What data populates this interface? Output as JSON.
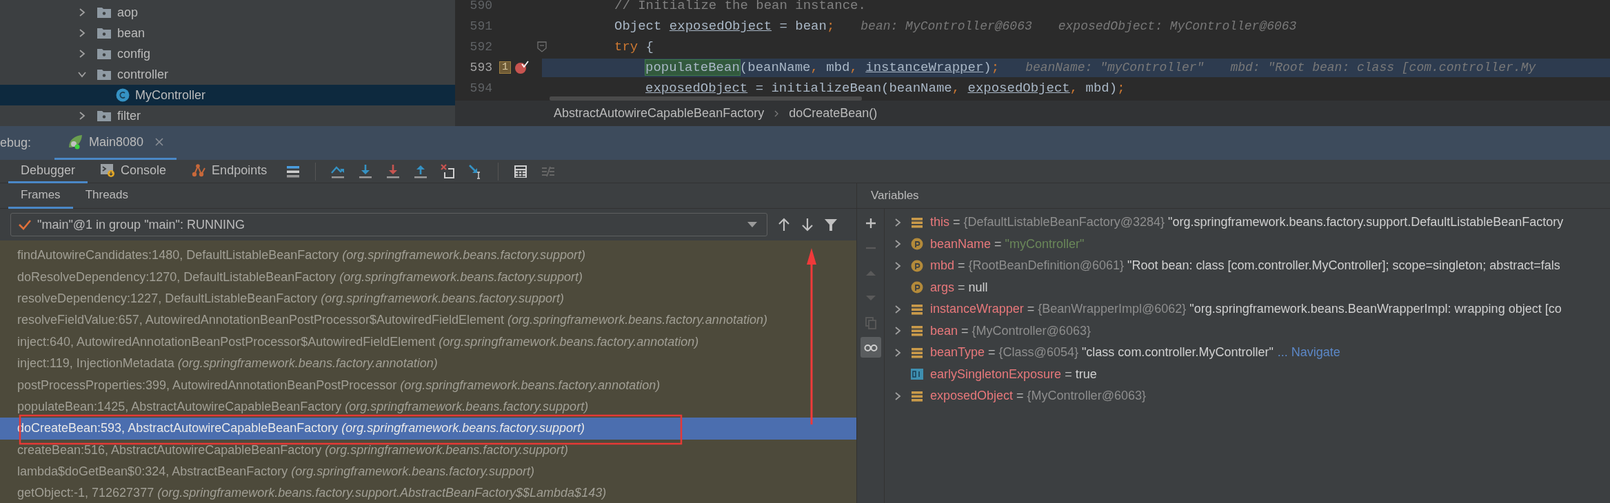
{
  "project_tree": {
    "items": [
      {
        "label": "aop",
        "kind": "folder",
        "expanded": false,
        "selected": false
      },
      {
        "label": "bean",
        "kind": "folder",
        "expanded": false,
        "selected": false
      },
      {
        "label": "config",
        "kind": "folder",
        "expanded": false,
        "selected": false
      },
      {
        "label": "controller",
        "kind": "folder",
        "expanded": true,
        "selected": false,
        "children": [
          {
            "label": "MyController",
            "kind": "class",
            "selected": true
          }
        ]
      },
      {
        "label": "filter",
        "kind": "folder",
        "expanded": false,
        "selected": false
      }
    ]
  },
  "editor": {
    "lines": [
      {
        "number": "590",
        "current": false,
        "foldable": false,
        "breakpoint": false,
        "code": [
          {
            "text": "// Initialize the bean instance.",
            "kind": "comment"
          }
        ]
      },
      {
        "number": "591",
        "current": false,
        "foldable": false,
        "breakpoint": false,
        "code": [
          {
            "text": "Object ",
            "kind": "plain"
          },
          {
            "text": "exposedObject",
            "kind": "var"
          },
          {
            "text": " = bean",
            "kind": "plain"
          },
          {
            "text": ";",
            "kind": "punct"
          }
        ],
        "hints": [
          "bean: MyController@6063",
          "exposedObject: MyController@6063"
        ]
      },
      {
        "number": "592",
        "current": false,
        "foldable": true,
        "breakpoint": false,
        "code": [
          {
            "text": "try",
            "kind": "keyword"
          },
          {
            "text": " {",
            "kind": "plain"
          }
        ]
      },
      {
        "number": "593",
        "current": true,
        "foldable": false,
        "breakpoint": true,
        "badge": "1",
        "nested": true,
        "code": [
          {
            "text": "populateBean",
            "kind": "call"
          },
          {
            "text": "(beanName",
            "kind": "plain"
          },
          {
            "text": ",",
            "kind": "punct"
          },
          {
            "text": " mbd",
            "kind": "plain"
          },
          {
            "text": ", ",
            "kind": "punct"
          },
          {
            "text": "instanceWrapper",
            "kind": "var"
          },
          {
            "text": ")",
            "kind": "plain"
          },
          {
            "text": ";",
            "kind": "punct"
          }
        ],
        "hints": [
          "beanName: \"myController\"",
          "mbd: \"Root bean: class [com.controller.My"
        ]
      },
      {
        "number": "594",
        "current": false,
        "foldable": false,
        "breakpoint": false,
        "nested": true,
        "code": [
          {
            "text": "exposedObject",
            "kind": "var"
          },
          {
            "text": " = initializeBean(beanName",
            "kind": "plain"
          },
          {
            "text": ", ",
            "kind": "punct"
          },
          {
            "text": "exposedObject",
            "kind": "var"
          },
          {
            "text": ",",
            "kind": "punct"
          },
          {
            "text": " mbd)",
            "kind": "plain"
          },
          {
            "text": ";",
            "kind": "punct"
          }
        ]
      }
    ],
    "breadcrumbs": [
      "AbstractAutowireCapableBeanFactory",
      "doCreateBean()"
    ]
  },
  "debug_bar": {
    "label": "ebug:",
    "tabs": [
      {
        "label": "Main8080",
        "selected": true
      }
    ]
  },
  "debug_tabs": [
    {
      "label": "Debugger",
      "kind": "debugger",
      "selected": true
    },
    {
      "label": "Console",
      "kind": "console",
      "selected": false
    },
    {
      "label": "Endpoints",
      "kind": "endpoints",
      "selected": false
    }
  ],
  "frames_panel": {
    "tabs": [
      {
        "label": "Frames",
        "selected": true
      },
      {
        "label": "Threads",
        "selected": false
      }
    ],
    "thread": "\"main\"@1 in group \"main\": RUNNING",
    "frames": [
      {
        "location": "findAutowireCandidates:1480, DefaultListableBeanFactory",
        "package": "(org.springframework.beans.factory.support)",
        "selected": false
      },
      {
        "location": "doResolveDependency:1270, DefaultListableBeanFactory",
        "package": "(org.springframework.beans.factory.support)",
        "selected": false
      },
      {
        "location": "resolveDependency:1227, DefaultListableBeanFactory",
        "package": "(org.springframework.beans.factory.support)",
        "selected": false
      },
      {
        "location": "resolveFieldValue:657, AutowiredAnnotationBeanPostProcessor$AutowiredFieldElement",
        "package": "(org.springframework.beans.factory.annotation)",
        "selected": false
      },
      {
        "location": "inject:640, AutowiredAnnotationBeanPostProcessor$AutowiredFieldElement",
        "package": "(org.springframework.beans.factory.annotation)",
        "selected": false
      },
      {
        "location": "inject:119, InjectionMetadata",
        "package": "(org.springframework.beans.factory.annotation)",
        "selected": false
      },
      {
        "location": "postProcessProperties:399, AutowiredAnnotationBeanPostProcessor",
        "package": "(org.springframework.beans.factory.annotation)",
        "selected": false
      },
      {
        "location": "populateBean:1425, AbstractAutowireCapableBeanFactory",
        "package": "(org.springframework.beans.factory.support)",
        "selected": false
      },
      {
        "location": "doCreateBean:593, AbstractAutowireCapableBeanFactory",
        "package": "(org.springframework.beans.factory.support)",
        "selected": true
      },
      {
        "location": "createBean:516, AbstractAutowireCapableBeanFactory",
        "package": "(org.springframework.beans.factory.support)",
        "selected": false
      },
      {
        "location": "lambda$doGetBean$0:324, AbstractBeanFactory",
        "package": "(org.springframework.beans.factory.support)",
        "selected": false
      },
      {
        "location": "getObject:-1, 712627377",
        "package": "(org.springframework.beans.factory.support.AbstractBeanFactory$$Lambda$143)",
        "selected": false
      }
    ]
  },
  "variables_panel": {
    "title": "Variables",
    "variables": [
      {
        "name": "this",
        "operator": "=",
        "kind": "field",
        "expandable": true,
        "type": "{DefaultListableBeanFactory@3284}",
        "value": "\"org.springframework.beans.factory.support.DefaultListableBeanFactory"
      },
      {
        "name": "beanName",
        "operator": "=",
        "kind": "param",
        "expandable": true,
        "string_value": "\"myController\""
      },
      {
        "name": "mbd",
        "operator": "=",
        "kind": "param",
        "expandable": true,
        "type": "{RootBeanDefinition@6061}",
        "value": "\"Root bean: class [com.controller.MyController]; scope=singleton; abstract=fals"
      },
      {
        "name": "args",
        "operator": "=",
        "kind": "param",
        "expandable": false,
        "value": "null"
      },
      {
        "name": "instanceWrapper",
        "operator": "=",
        "kind": "field",
        "expandable": true,
        "type": "{BeanWrapperImpl@6062}",
        "value": "\"org.springframework.beans.BeanWrapperImpl: wrapping object [co"
      },
      {
        "name": "bean",
        "operator": "=",
        "kind": "field",
        "expandable": true,
        "type": "{MyController@6063}"
      },
      {
        "name": "beanType",
        "operator": "=",
        "kind": "field",
        "expandable": true,
        "type": "{Class@6054}",
        "value": "\"class com.controller.MyController\"",
        "link": "... Navigate"
      },
      {
        "name": "earlySingletonExposure",
        "operator": "=",
        "kind": "primitive",
        "expandable": false,
        "value": "true"
      },
      {
        "name": "exposedObject",
        "operator": "=",
        "kind": "field",
        "expandable": true,
        "type": "{MyController@6063}"
      }
    ]
  }
}
